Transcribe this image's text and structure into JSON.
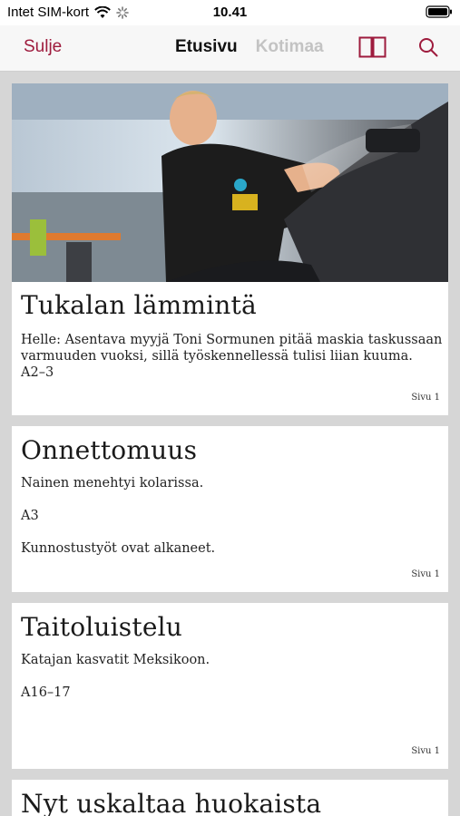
{
  "status": {
    "carrier": "Intet SIM-kort",
    "time": "10.41"
  },
  "nav": {
    "close_label": "Sulje",
    "tabs": [
      "Etusivu",
      "Kotimaa"
    ],
    "icons": [
      "pages-icon",
      "search-icon"
    ],
    "accent_color": "#9e1b3d"
  },
  "articles": [
    {
      "title": "Tukalan lämmintä",
      "lines": [
        "Helle: Asentava myyjä Toni Sormunen pitää maskia taskussaan varmuuden vuoksi, sillä työskennellessä tulisi liian kuuma.",
        "A2–3"
      ],
      "page": "Sivu 1"
    },
    {
      "title": "Onnettomuus",
      "lines": [
        "Nainen menehtyi kolarissa.",
        "A3",
        "Kunnostustyöt ovat alkaneet."
      ],
      "page": "Sivu 1"
    },
    {
      "title": "Taitoluistelu",
      "lines": [
        "Katajan kasvatit Meksikoon.",
        "A16–17"
      ],
      "page": "Sivu 1"
    },
    {
      "title": "Nyt uskaltaa huokaista",
      "lines": [],
      "page": ""
    }
  ]
}
